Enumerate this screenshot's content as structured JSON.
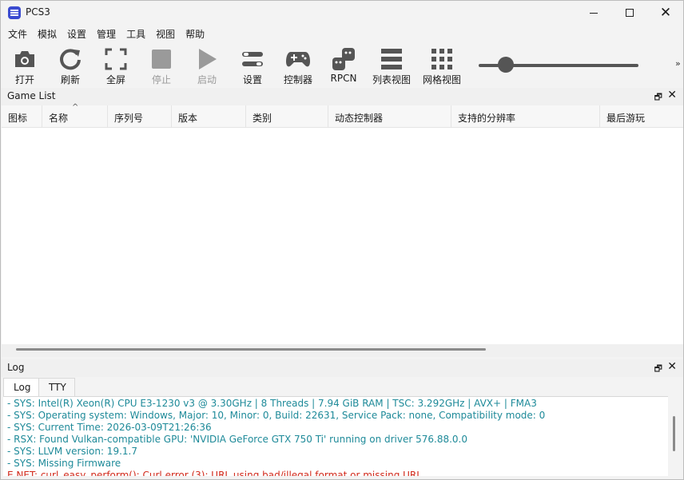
{
  "window": {
    "title": "PCS3"
  },
  "menu": [
    "文件",
    "模拟",
    "设置",
    "管理",
    "工具",
    "视图",
    "帮助"
  ],
  "toolbar": [
    {
      "id": "open",
      "label": "打开",
      "icon": "camera-icon",
      "enabled": true
    },
    {
      "id": "refresh",
      "label": "刷新",
      "icon": "refresh-icon",
      "enabled": true
    },
    {
      "id": "fullscreen",
      "label": "全屏",
      "icon": "fullscreen-icon",
      "enabled": true
    },
    {
      "id": "stop",
      "label": "停止",
      "icon": "stop-icon",
      "enabled": false
    },
    {
      "id": "start",
      "label": "启动",
      "icon": "play-icon",
      "enabled": false
    },
    {
      "id": "settings",
      "label": "设置",
      "icon": "settings-sliders-icon",
      "enabled": true
    },
    {
      "id": "pads",
      "label": "控制器",
      "icon": "gamepad-icon",
      "enabled": true
    },
    {
      "id": "rpcn",
      "label": "RPCN",
      "icon": "rpcn-icon",
      "enabled": true
    },
    {
      "id": "listview",
      "label": "列表视图",
      "icon": "list-view-icon",
      "enabled": true
    },
    {
      "id": "gridview",
      "label": "网格视图",
      "icon": "grid-view-icon",
      "enabled": true
    }
  ],
  "zoom": {
    "value_fraction": 0.17
  },
  "game_list": {
    "title": "Game List",
    "columns": [
      "图标",
      "名称",
      "序列号",
      "版本",
      "类别",
      "动态控制器",
      "支持的分辨率",
      "最后游玩"
    ],
    "sorted_column": "名称",
    "rows": []
  },
  "log": {
    "title": "Log",
    "tabs": [
      "Log",
      "TTY"
    ],
    "active_tab": "Log",
    "colors": {
      "info": "#1e8a99",
      "error": "#d22a1c"
    },
    "lines": [
      {
        "text": "- SYS: Intel(R) Xeon(R) CPU E3-1230 v3 @ 3.30GHz | 8 Threads | 7.94 GiB RAM | TSC: 3.292GHz | AVX+ | FMA3",
        "level": "info"
      },
      {
        "text": "- SYS: Operating system: Windows, Major: 10, Minor: 0, Build: 22631, Service Pack: none, Compatibility mode: 0",
        "level": "info"
      },
      {
        "text": "- SYS: Current Time: 2026-03-09T21:26:36",
        "level": "info"
      },
      {
        "text": "- RSX: Found Vulkan-compatible GPU: 'NVIDIA GeForce GTX 750 Ti' running on driver 576.88.0.0",
        "level": "info"
      },
      {
        "text": "- SYS: LLVM version: 19.1.7",
        "level": "info"
      },
      {
        "text": "- SYS: Missing Firmware",
        "level": "info"
      },
      {
        "text": "E NET: curl_easy_perform(): Curl error (3): URL using bad/illegal format or missing URL",
        "level": "error"
      }
    ]
  }
}
